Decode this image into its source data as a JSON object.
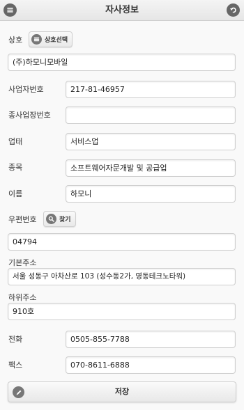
{
  "header": {
    "title": "자사정보",
    "menu_icon": "list-icon",
    "back_icon": "back-arrow-icon"
  },
  "company": {
    "label": "상호",
    "select_button": "상호선택",
    "select_icon": "list-icon",
    "value": "(주)하모니모바일"
  },
  "business_number": {
    "label": "사업자번호",
    "value": "217-81-46957"
  },
  "branch_number": {
    "label": "종사업장번호",
    "value": ""
  },
  "business_type": {
    "label": "업태",
    "value": "서비스업"
  },
  "business_item": {
    "label": "종목",
    "value": "소프트웨어자문개발 및 공급업"
  },
  "name": {
    "label": "이름",
    "value": "하모니"
  },
  "postal": {
    "label": "우편번호",
    "find_button": "찾기",
    "find_icon": "search-icon",
    "value": "04794"
  },
  "address": {
    "label": "기본주소",
    "value": "서울 성동구 아차산로 103 (성수동2가, 영동테크노타워)"
  },
  "address_detail": {
    "label": "하위주소",
    "value": "910호"
  },
  "phone": {
    "label": "전화",
    "value": "0505-855-7788"
  },
  "fax": {
    "label": "팩스",
    "value": "070-8611-6888"
  },
  "save": {
    "label": "저장",
    "icon": "pencil-icon"
  }
}
